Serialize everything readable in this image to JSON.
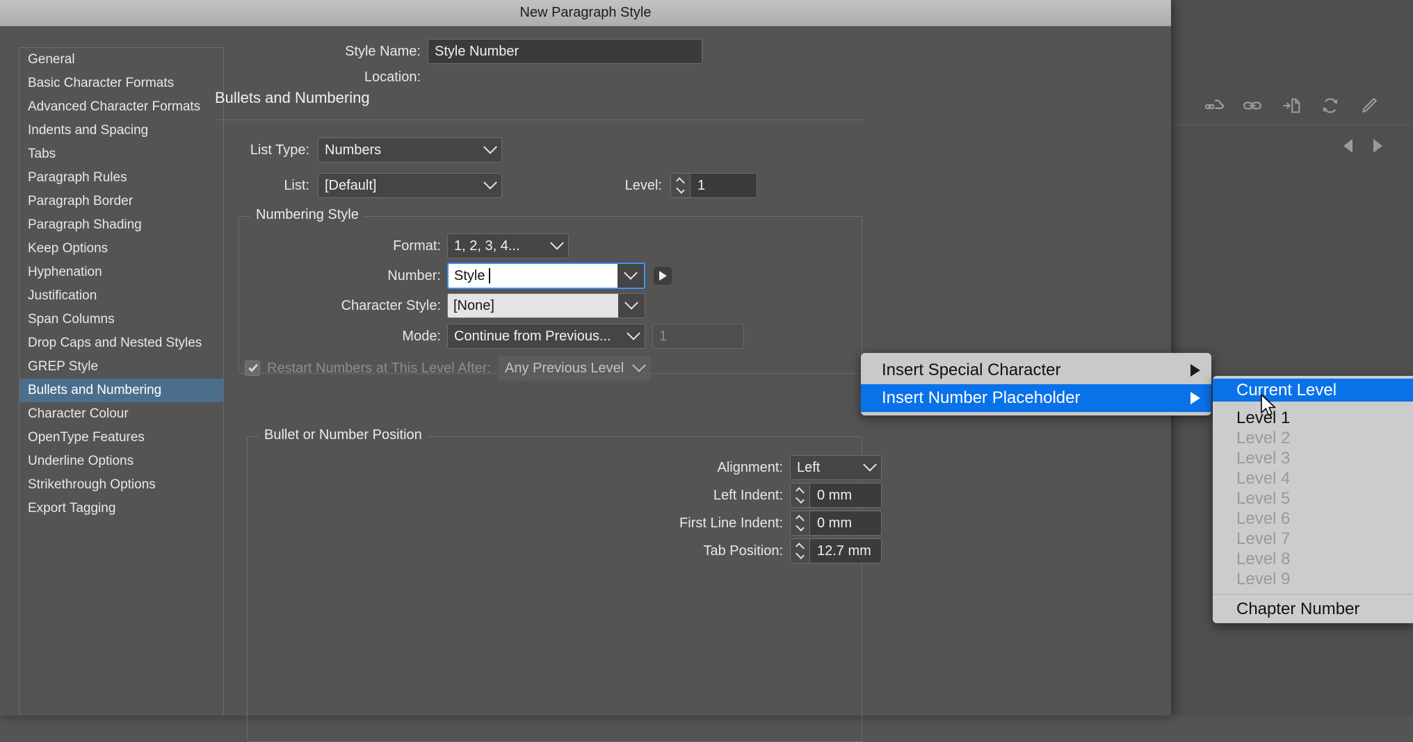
{
  "window": {
    "title": "New Paragraph Style"
  },
  "sidebar": {
    "items": [
      {
        "label": "General",
        "selected": false
      },
      {
        "label": "Basic Character Formats",
        "selected": false
      },
      {
        "label": "Advanced Character Formats",
        "selected": false
      },
      {
        "label": "Indents and Spacing",
        "selected": false
      },
      {
        "label": "Tabs",
        "selected": false
      },
      {
        "label": "Paragraph Rules",
        "selected": false
      },
      {
        "label": "Paragraph Border",
        "selected": false
      },
      {
        "label": "Paragraph Shading",
        "selected": false
      },
      {
        "label": "Keep Options",
        "selected": false
      },
      {
        "label": "Hyphenation",
        "selected": false
      },
      {
        "label": "Justification",
        "selected": false
      },
      {
        "label": "Span Columns",
        "selected": false
      },
      {
        "label": "Drop Caps and Nested Styles",
        "selected": false
      },
      {
        "label": "GREP Style",
        "selected": false
      },
      {
        "label": "Bullets and Numbering",
        "selected": true
      },
      {
        "label": "Character Colour",
        "selected": false
      },
      {
        "label": "OpenType Features",
        "selected": false
      },
      {
        "label": "Underline Options",
        "selected": false
      },
      {
        "label": "Strikethrough Options",
        "selected": false
      },
      {
        "label": "Export Tagging",
        "selected": false
      }
    ]
  },
  "header": {
    "style_name_label": "Style Name:",
    "style_name_value": "Style Number",
    "location_label": "Location:",
    "location_value": "",
    "section_title": "Bullets and Numbering"
  },
  "list_settings": {
    "list_type_label": "List Type:",
    "list_type_value": "Numbers",
    "list_label": "List:",
    "list_value": "[Default]",
    "level_label": "Level:",
    "level_value": "1"
  },
  "numbering_style": {
    "legend": "Numbering Style",
    "format_label": "Format:",
    "format_value": "1, 2, 3, 4...",
    "number_label": "Number:",
    "number_value": "Style ",
    "character_style_label": "Character Style:",
    "character_style_value": "[None]",
    "mode_label": "Mode:",
    "mode_value": "Continue from Previous...",
    "mode_number_value": "1",
    "restart_label": "Restart Numbers at This Level After:",
    "restart_checked": true,
    "restart_value": "Any Previous Level"
  },
  "position": {
    "legend": "Bullet or Number Position",
    "alignment_label": "Alignment:",
    "alignment_value": "Left",
    "left_indent_label": "Left Indent:",
    "left_indent_value": "0 mm",
    "first_line_indent_label": "First Line Indent:",
    "first_line_indent_value": "0 mm",
    "tab_position_label": "Tab Position:",
    "tab_position_value": "12.7 mm"
  },
  "context_menu": {
    "items": [
      {
        "label": "Insert Special Character",
        "active": false,
        "has_submenu": true
      },
      {
        "label": "Insert Number Placeholder",
        "active": true,
        "has_submenu": true
      }
    ]
  },
  "submenu": {
    "items": [
      {
        "label": "Current Level",
        "state": "active"
      },
      {
        "label": "Level 1",
        "state": "enabled"
      },
      {
        "label": "Level 2",
        "state": "disabled"
      },
      {
        "label": "Level 3",
        "state": "disabled"
      },
      {
        "label": "Level 4",
        "state": "disabled"
      },
      {
        "label": "Level 5",
        "state": "disabled"
      },
      {
        "label": "Level 6",
        "state": "disabled"
      },
      {
        "label": "Level 7",
        "state": "disabled"
      },
      {
        "label": "Level 8",
        "state": "disabled"
      },
      {
        "label": "Level 9",
        "state": "disabled"
      },
      {
        "label": "Chapter Number",
        "state": "enabled"
      }
    ]
  },
  "background_panel": {
    "icons": [
      "cloud-link-icon",
      "link-icon",
      "place-file-icon",
      "refresh-icon",
      "pencil-icon"
    ],
    "nav": [
      "previous-arrow-icon",
      "next-arrow-icon"
    ]
  },
  "colors": {
    "dialog_bg": "#545454",
    "titlebar": "#b8b8b8",
    "sidebar_selected": "#4b6e8d",
    "menu_bg": "#c9c9c9",
    "menu_highlight": "#0a72e8",
    "focus_border": "#3d95ef"
  }
}
